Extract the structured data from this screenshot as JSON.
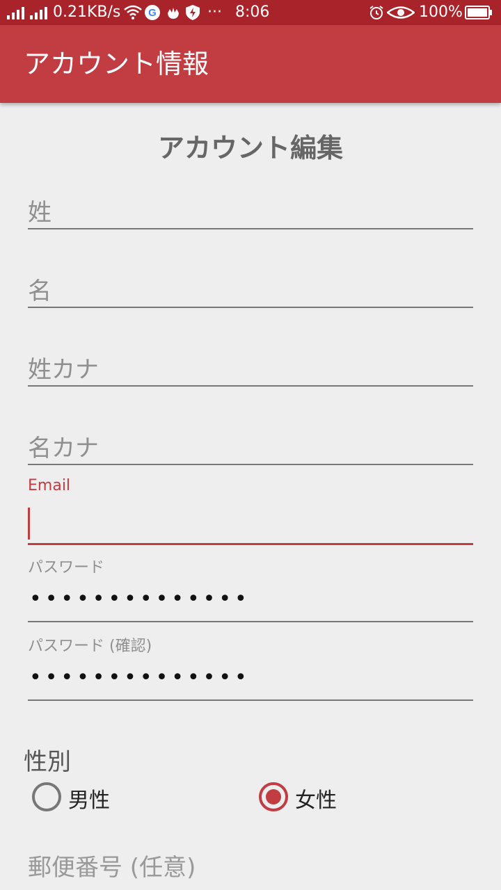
{
  "status_bar": {
    "signal_icon": "signal-bars-icon",
    "speed": "0.21KB/s",
    "wifi_icon": "wifi-icon",
    "google_icon": "google-icon",
    "app_icon": "hand-icon",
    "shield_icon": "shield-icon",
    "more": "···",
    "time": "8:06",
    "alarm_icon": "alarm-icon",
    "eye_icon": "eye-icon",
    "battery": "100%",
    "battery_icon": "battery-icon"
  },
  "app_bar": {
    "title": "アカウント情報"
  },
  "form": {
    "heading": "アカウント編集",
    "last_name": {
      "placeholder": "姓"
    },
    "first_name": {
      "placeholder": "名"
    },
    "last_name_kana": {
      "placeholder": "姓カナ"
    },
    "first_name_kana": {
      "placeholder": "名カナ"
    },
    "email": {
      "label": "Email",
      "value": ""
    },
    "password": {
      "label": "パスワード",
      "value": "••••••••••••••"
    },
    "password_confirm": {
      "label": "パスワード (確認)",
      "value": "••••••••••••••"
    },
    "gender": {
      "label": "性別",
      "options": [
        {
          "label": "男性",
          "selected": false
        },
        {
          "label": "女性",
          "selected": true
        }
      ]
    },
    "postal_code": {
      "placeholder": "郵便番号 (任意)"
    }
  },
  "colors": {
    "accent": "#c13d42",
    "status_bar": "#a8232a",
    "background": "#eeeeee"
  }
}
